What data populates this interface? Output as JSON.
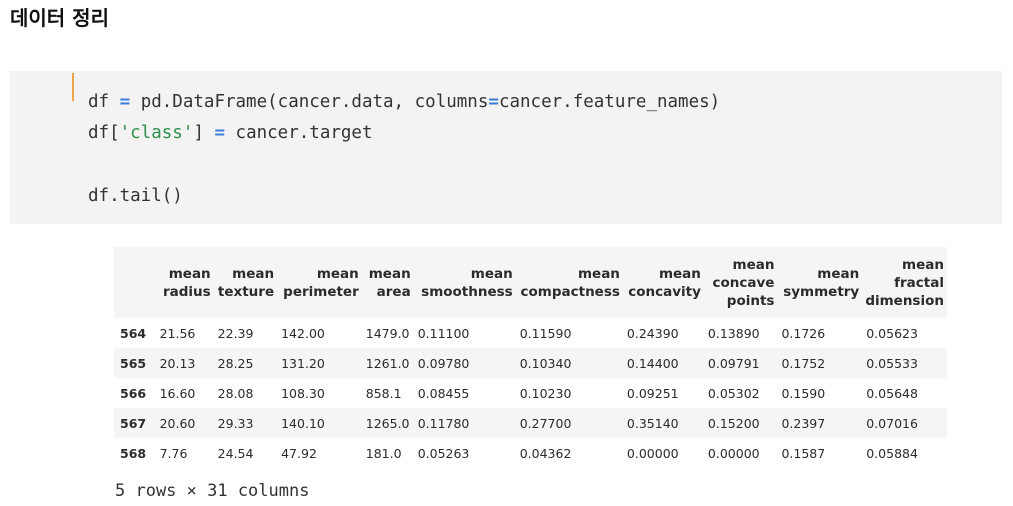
{
  "section_title": "데이터 정리",
  "code": {
    "line1": {
      "a": "df ",
      "op1": "=",
      "b": " pd.DataFrame(cancer.data, columns",
      "op2": "=",
      "c": "cancer.feature_names)"
    },
    "line2": {
      "a": "df[",
      "str": "'class'",
      "b": "] ",
      "op": "=",
      "c": " cancer.target"
    },
    "line3": "df.tail()"
  },
  "table": {
    "columns": [
      "",
      "mean radius",
      "mean texture",
      "mean perimeter",
      "mean area",
      "mean smoothness",
      "mean compactness",
      "mean concavity",
      "mean concave points",
      "mean symmetry",
      "mean fractal dimension"
    ],
    "rows": [
      [
        "564",
        "21.56",
        "22.39",
        "142.00",
        "1479.0",
        "0.11100",
        "0.11590",
        "0.24390",
        "0.13890",
        "0.1726",
        "0.05623"
      ],
      [
        "565",
        "20.13",
        "28.25",
        "131.20",
        "1261.0",
        "0.09780",
        "0.10340",
        "0.14400",
        "0.09791",
        "0.1752",
        "0.05533"
      ],
      [
        "566",
        "16.60",
        "28.08",
        "108.30",
        "858.1",
        "0.08455",
        "0.10230",
        "0.09251",
        "0.05302",
        "0.1590",
        "0.05648"
      ],
      [
        "567",
        "20.60",
        "29.33",
        "140.10",
        "1265.0",
        "0.11780",
        "0.27700",
        "0.35140",
        "0.15200",
        "0.2397",
        "0.07016"
      ],
      [
        "568",
        "7.76",
        "24.54",
        "47.92",
        "181.0",
        "0.05263",
        "0.04362",
        "0.00000",
        "0.00000",
        "0.1587",
        "0.05884"
      ]
    ]
  },
  "shape_text": "5 rows × 31 columns"
}
